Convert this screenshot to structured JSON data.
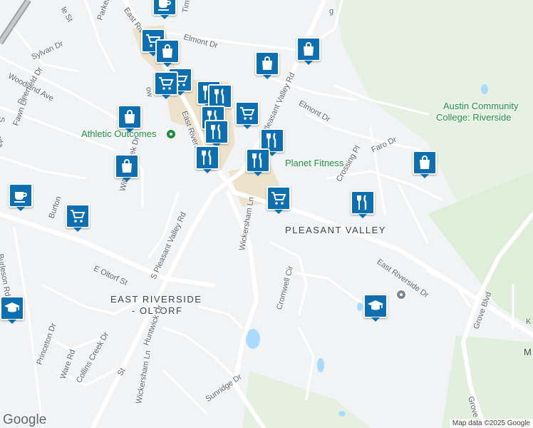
{
  "map": {
    "neighborhoods": [
      "PLEASANT VALLEY",
      "EAST RIVERSIDE",
      "- OLTORF"
    ],
    "places": {
      "athletic": "Athletic Outcomes",
      "fitness": "Planet Fitness",
      "college_line1": "Austin Community",
      "college_line2": "College: Riverside"
    },
    "streets": {
      "parker": "Parker Ln",
      "sylvan": "Sylvan Dr",
      "woodland": "Woodland Ave",
      "deerfield": "Deerfield Dr",
      "fawn": "Fawn Dr",
      "elmont_w": "Elmont Dr",
      "elmont_e": "Elmont Dr",
      "timm": "Timm",
      "pleasant_valley_n": "Pleasant Valley Rd",
      "pleasant_valley_s": "S Pleasant Valley Rd",
      "east_riverside_n": "East Riversi",
      "east_riverside_top": "East Rive",
      "east_riverside_se": "East Riverside Dr",
      "willow_creek": "Willow Creek Dr",
      "burleson": "Burleson Rd",
      "burton": "Burton",
      "e_oltorf": "E Oltorf St",
      "wickersham_n": "Wickersham Ln",
      "wickersham_s": "Wickersham Ln",
      "cromwell": "Cromwell Cir",
      "crossing": "Crossing Pl",
      "faro": "Faro Dr",
      "grove_1": "Grove Blvd",
      "grove_2": "Grove Blvd",
      "princeton": "Princeton Dr",
      "ware": "Ware Rd",
      "collins": "Collins Creek Dr",
      "huntwick": "Huntwick Dr",
      "sunridge": "Sunridge Dr",
      "frag_st": "St",
      "frag_le_st": "le St",
      "frag_s": "S",
      "frag_rda": "rda",
      "frag_k": "K",
      "frag_m": "M",
      "frag_g": "g",
      "frag_ow": "ow"
    },
    "markers": [
      {
        "type": "coffee",
        "name": "cafe-marker"
      },
      {
        "type": "cart",
        "name": "grocery-marker"
      },
      {
        "type": "bag",
        "name": "shopping-marker"
      },
      {
        "type": "bag",
        "name": "shopping-marker"
      },
      {
        "type": "bag",
        "name": "shopping-marker"
      },
      {
        "type": "cart",
        "name": "grocery-marker"
      },
      {
        "type": "cart",
        "name": "grocery-marker"
      },
      {
        "type": "bag",
        "name": "shopping-marker"
      },
      {
        "type": "fork",
        "name": "restaurant-marker"
      },
      {
        "type": "fork",
        "name": "restaurant-marker"
      },
      {
        "type": "cart",
        "name": "grocery-marker"
      },
      {
        "type": "fork",
        "name": "restaurant-marker"
      },
      {
        "type": "fork",
        "name": "restaurant-marker"
      },
      {
        "type": "fork",
        "name": "restaurant-marker"
      },
      {
        "type": "fork",
        "name": "restaurant-marker"
      },
      {
        "type": "fork",
        "name": "restaurant-marker"
      },
      {
        "type": "bag",
        "name": "shopping-marker"
      },
      {
        "type": "coffee",
        "name": "cafe-marker"
      },
      {
        "type": "cart",
        "name": "grocery-marker"
      },
      {
        "type": "cart",
        "name": "grocery-marker"
      },
      {
        "type": "fork",
        "name": "restaurant-marker"
      },
      {
        "type": "bag",
        "name": "shopping-marker"
      },
      {
        "type": "school",
        "name": "school-marker"
      },
      {
        "type": "school",
        "name": "school-marker"
      }
    ],
    "logo": "Google",
    "attribution": "Map data ©2025 Google"
  }
}
